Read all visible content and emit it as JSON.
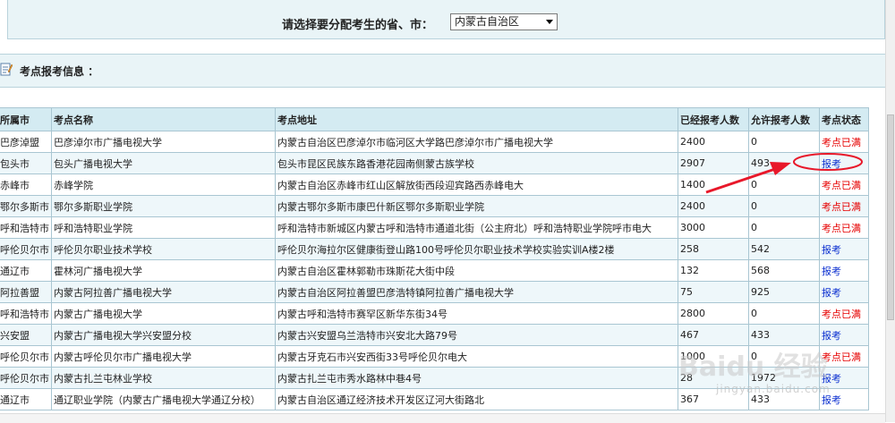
{
  "region_select": {
    "label": "请选择要分配考生的省、市：",
    "selected": "内蒙古自治区"
  },
  "section": {
    "title": "考点报考信息 ："
  },
  "table": {
    "headers": {
      "city": "所属市",
      "name": "考点名称",
      "address": "考点地址",
      "registered": "已经报考人数",
      "allowed": "允许报考人数",
      "status": "考点状态"
    },
    "rows": [
      {
        "city": "巴彦淖盟",
        "name": "巴彦淖尔市广播电视大学",
        "address": "内蒙古自治区巴彦淖尔市临河区大学路巴彦淖尔市广播电视大学",
        "registered": "2400",
        "allowed": "0",
        "status": "考点已满"
      },
      {
        "city": "包头市",
        "name": "包头广播电视大学",
        "address": "包头市昆区民族东路香港花园南侧蒙古族学校",
        "registered": "2907",
        "allowed": "493",
        "status": "报考"
      },
      {
        "city": "赤峰市",
        "name": "赤峰学院",
        "address": "内蒙古自治区赤峰市红山区解放街西段迎宾路西赤峰电大",
        "registered": "1400",
        "allowed": "0",
        "status": "考点已满"
      },
      {
        "city": "鄂尔多斯市",
        "name": "鄂尔多斯职业学院",
        "address": "内蒙古鄂尔多斯市康巴什新区鄂尔多斯职业学院",
        "registered": "2400",
        "allowed": "0",
        "status": "考点已满"
      },
      {
        "city": "呼和浩特市",
        "name": "呼和浩特职业学院",
        "address": "呼和浩特市新城区内蒙古呼和浩特市通道北街（公主府北）呼和浩特职业学院呼市电大",
        "registered": "3000",
        "allowed": "0",
        "status": "考点已满"
      },
      {
        "city": "呼伦贝尔市",
        "name": "呼伦贝尔职业技术学校",
        "address": "呼伦贝尔海拉尔区健康街登山路100号呼伦贝尔职业技术学校实验实训A楼2楼",
        "registered": "258",
        "allowed": "542",
        "status": "报考"
      },
      {
        "city": "通辽市",
        "name": "霍林河广播电视大学",
        "address": "内蒙古自治区霍林郭勒市珠斯花大街中段",
        "registered": "132",
        "allowed": "568",
        "status": "报考"
      },
      {
        "city": "阿拉善盟",
        "name": "内蒙古阿拉善广播电视大学",
        "address": "内蒙古自治区阿拉善盟巴彦浩特镇阿拉善广播电视大学",
        "registered": "75",
        "allowed": "925",
        "status": "报考"
      },
      {
        "city": "呼和浩特市",
        "name": "内蒙古广播电视大学",
        "address": "内蒙古呼和浩特市赛罕区新华东街34号",
        "registered": "2800",
        "allowed": "0",
        "status": "考点已满"
      },
      {
        "city": "兴安盟",
        "name": "内蒙古广播电视大学兴安盟分校",
        "address": "内蒙古兴安盟乌兰浩特市兴安北大路79号",
        "registered": "467",
        "allowed": "433",
        "status": "报考"
      },
      {
        "city": "呼伦贝尔市",
        "name": "内蒙古呼伦贝尔市广播电视大学",
        "address": "内蒙古牙克石市兴安西街33号呼伦贝尔电大",
        "registered": "1000",
        "allowed": "0",
        "status": "考点已满"
      },
      {
        "city": "呼伦贝尔市",
        "name": "内蒙古扎兰屯林业学校",
        "address": "内蒙古扎兰屯市秀水路林中巷4号",
        "registered": "28",
        "allowed": "1972",
        "status": "报考"
      },
      {
        "city": "通辽市",
        "name": "通辽职业学院（内蒙古广播电视大学通辽分校）",
        "address": "内蒙古自治区通辽经济技术开发区辽河大街路北",
        "registered": "367",
        "allowed": "433",
        "status": "报考"
      }
    ]
  },
  "watermark": {
    "brand": "Baidu 经验",
    "sub": "jingyan.baidu.com"
  },
  "colors": {
    "full": "#e60000",
    "open": "#0b2fd0",
    "annotation": "#e8182a",
    "header_bg": "#d4ebf2"
  }
}
